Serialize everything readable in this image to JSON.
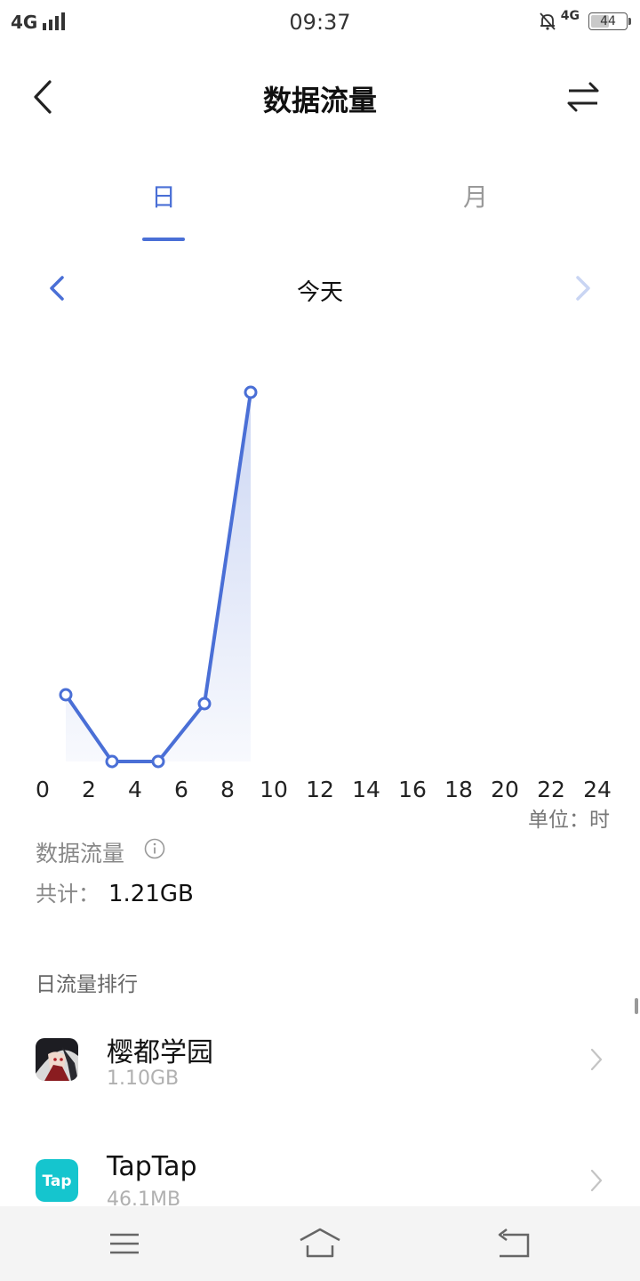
{
  "status_bar": {
    "network": "4G",
    "time": "09:37",
    "network_right": "4G",
    "battery": "44",
    "icons": [
      "signal-icon",
      "bell-off-icon",
      "battery-icon"
    ]
  },
  "header": {
    "title": "数据流量",
    "back_icon": "back-arrow-icon",
    "switch_icon": "swap-arrows-icon"
  },
  "tabs": [
    {
      "label": "日",
      "active": true
    },
    {
      "label": "月",
      "active": false
    }
  ],
  "date_nav": {
    "label": "今天",
    "prev_icon": "chevron-left-icon",
    "next_icon": "chevron-right-icon"
  },
  "colors": {
    "accent": "#4a6fd6",
    "muted": "#999999"
  },
  "chart_data": {
    "type": "line",
    "x_ticks": [
      0,
      2,
      4,
      6,
      8,
      10,
      12,
      14,
      16,
      18,
      20,
      22,
      24
    ],
    "xlim": [
      0,
      24
    ],
    "series": [
      {
        "x": [
          1,
          3,
          5,
          7,
          9
        ],
        "y": [
          0.15,
          0.0,
          0.0,
          0.13,
          0.83
        ]
      }
    ],
    "ylim": [
      0,
      0.9
    ],
    "unit_label": "单位：时",
    "grid": false,
    "legend": "none"
  },
  "summary": {
    "title": "数据流量",
    "info_icon": "info-icon",
    "total_label": "共计：",
    "total_value": "1.21GB"
  },
  "ranking": {
    "title": "日流量排行",
    "apps": [
      {
        "name": "樱都学园",
        "size": "1.10GB",
        "icon": "anime-game-icon"
      },
      {
        "name": "TapTap",
        "size": "46.1MB",
        "icon": "taptap-icon"
      }
    ]
  },
  "bottom_nav": {
    "menu_icon": "menu-icon",
    "home_icon": "home-icon",
    "back_icon": "back-icon"
  }
}
